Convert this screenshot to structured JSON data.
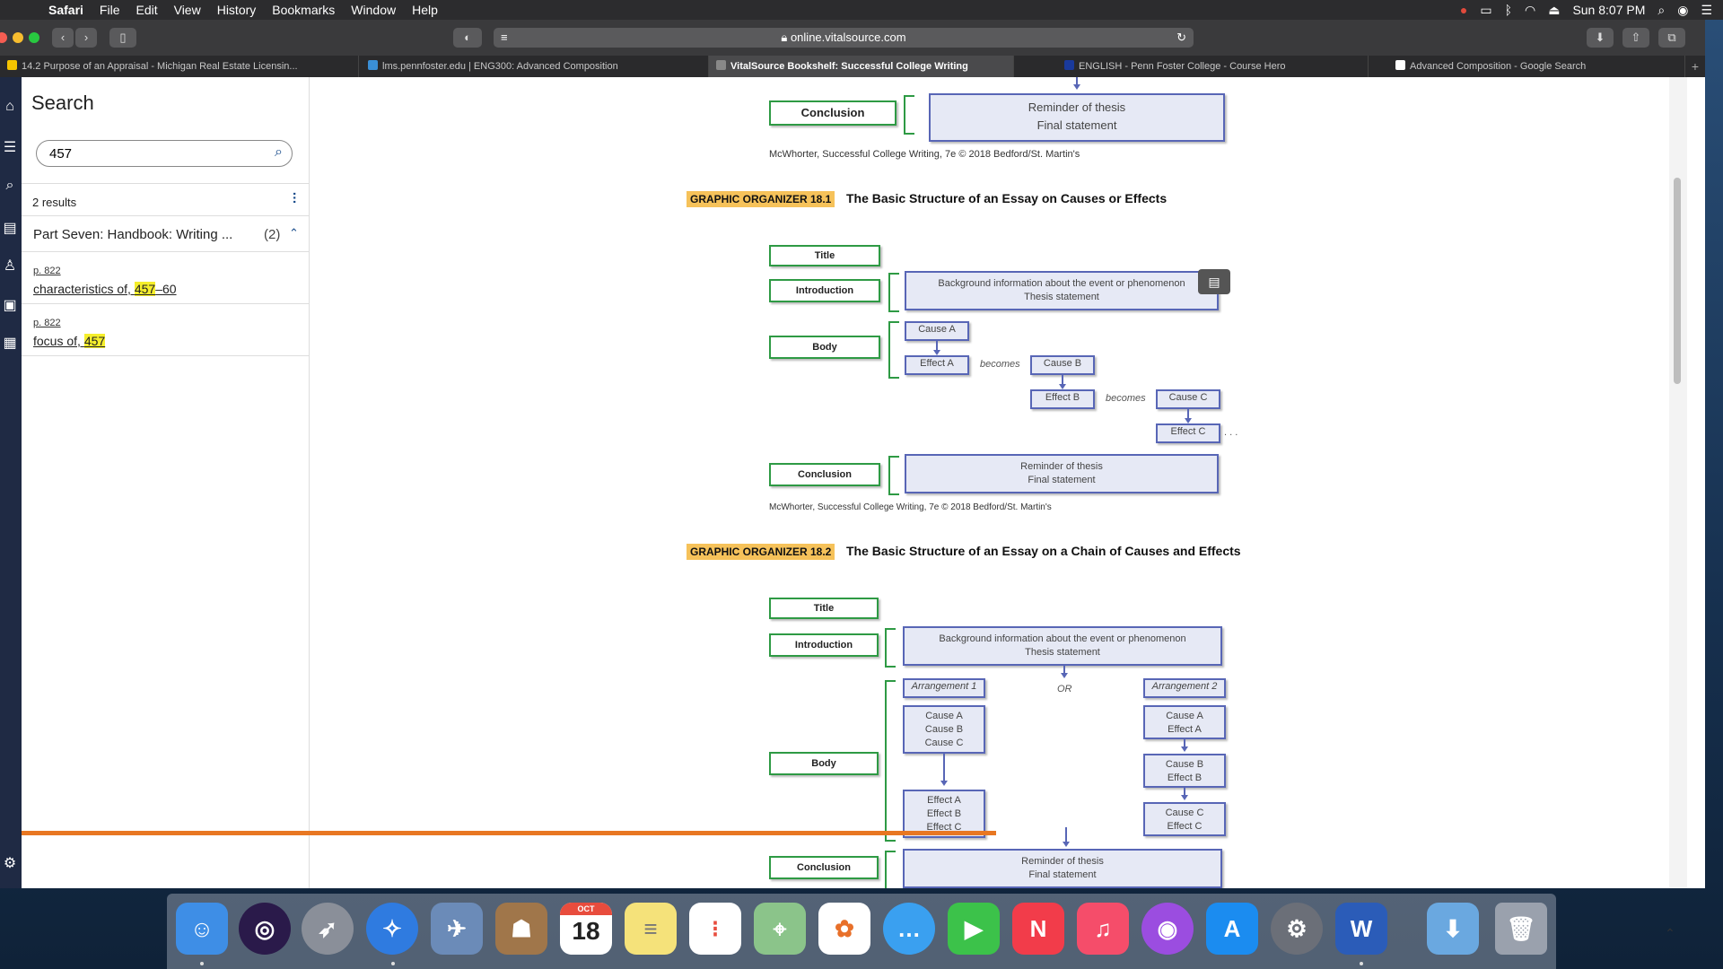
{
  "menubar": {
    "app": "Safari",
    "items": [
      "File",
      "Edit",
      "View",
      "History",
      "Bookmarks",
      "Window",
      "Help"
    ],
    "clock": "Sun 8:07 PM"
  },
  "browser": {
    "url": "online.vitalsource.com",
    "tabs": [
      {
        "label": "14.2 Purpose of an Appraisal - Michigan Real Estate Licensin...",
        "fav_color": "#f5c400"
      },
      {
        "label": "lms.pennfoster.edu | ENG300: Advanced Composition",
        "fav_color": "#3a8fd6"
      },
      {
        "label": "VitalSource Bookshelf: Successful College Writing",
        "fav_color": "#888888",
        "active": true
      },
      {
        "label": "ENGLISH - Penn Foster College - Course Hero",
        "fav_color": "#1a3a9c"
      },
      {
        "label": "Advanced Composition - Google Search",
        "fav_color": "#ffffff"
      }
    ]
  },
  "search_panel": {
    "title": "Search",
    "query": "457",
    "results_count": "2 results",
    "group": {
      "label": "Part Seven: Handbook: Writing ...",
      "count": "(2)"
    },
    "results": [
      {
        "page": "p. 822",
        "prefix": "characteristics of, ",
        "highlight": "457",
        "suffix": "–60"
      },
      {
        "page": "p. 822",
        "prefix": "focus of, ",
        "highlight": "457",
        "suffix": ""
      }
    ]
  },
  "reader": {
    "top_conclusion": {
      "label": "Conclusion",
      "line1": "Reminder of thesis",
      "line2": "Final statement"
    },
    "credit": "McWhorter, Successful College Writing, 7e © 2018 Bedford/St. Martin's",
    "go1": {
      "tag": "GRAPHIC ORGANIZER 18.1",
      "title": "The Basic Structure of an Essay on Causes or Effects",
      "title_box": "Title",
      "intro": "Introduction",
      "intro_line1": "Background information about the event or phenomenon",
      "intro_line2": "Thesis statement",
      "body": "Body",
      "cause_a": "Cause A",
      "effect_a": "Effect A",
      "cause_b": "Cause B",
      "effect_b": "Effect B",
      "cause_c": "Cause C",
      "effect_c": "Effect C",
      "becomes": "becomes",
      "ellipsis": ". . .",
      "conclusion": "Conclusion",
      "conc_line1": "Reminder of thesis",
      "conc_line2": "Final statement"
    },
    "go2": {
      "tag": "GRAPHIC ORGANIZER 18.2",
      "title": "The Basic Structure of an Essay on a Chain of Causes and Effects",
      "title_box": "Title",
      "intro": "Introduction",
      "intro_line1": "Background information about the event or phenomenon",
      "intro_line2": "Thesis statement",
      "or": "OR",
      "arr1": "Arrangement 1",
      "arr2": "Arrangement 2",
      "causes_a1": "Cause A",
      "causes_b1": "Cause B",
      "causes_c1": "Cause C",
      "effects_a1": "Effect A",
      "effects_b1": "Effect B",
      "effects_c1": "Effect C",
      "a2_cause_a": "Cause A",
      "a2_effect_a": "Effect A",
      "a2_cause_b": "Cause B",
      "a2_effect_b": "Effect B",
      "a2_cause_c": "Cause C",
      "a2_effect_c": "Effect C",
      "body": "Body",
      "conclusion": "Conclusion",
      "conc_line1": "Reminder of thesis",
      "conc_line2": "Final statement"
    }
  },
  "dock": {
    "calendar_month": "OCT",
    "calendar_day": "18"
  }
}
